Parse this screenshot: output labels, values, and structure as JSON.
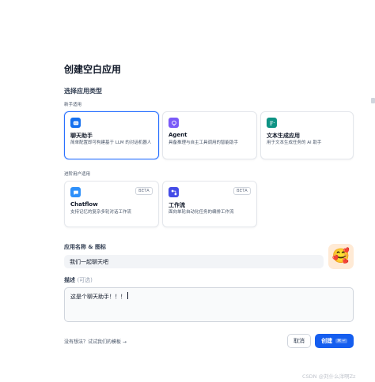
{
  "dialog": {
    "title": "创建空白应用",
    "section_title": "选择应用类型",
    "beginner_label": "新手适用",
    "advanced_label": "进阶用户适用"
  },
  "app_types": [
    {
      "name": "聊天助手",
      "desc": "简单配置即可构建基于 LLM 的对话机器人",
      "icon": "chat-bot-icon",
      "color": "#1570ef",
      "selected": true
    },
    {
      "name": "Agent",
      "desc": "具备推理与自主工具调用的智能助手",
      "icon": "agent-icon",
      "color": "#7a5af8",
      "selected": false
    },
    {
      "name": "文本生成应用",
      "desc": "用于文本生成任务的 AI 助手",
      "icon": "text-generator-icon",
      "color": "#0e9384",
      "selected": false
    },
    {
      "name": "Chatflow",
      "desc": "支持记忆的复杂多轮对话工作流",
      "icon": "chatflow-icon",
      "color": "#2e90fa",
      "badge": "BETA",
      "selected": false
    },
    {
      "name": "工作流",
      "desc": "面向单轮自动化任务的编排工作流",
      "icon": "workflow-icon",
      "color": "#444ce7",
      "badge": "BETA",
      "selected": false
    }
  ],
  "app_name": {
    "label": "应用名称 & 图标",
    "value": "我们一起聊天吧",
    "emoji": "🥰",
    "emoji_bg": "#ffead5"
  },
  "description": {
    "label": "描述",
    "optional": "(可选)",
    "value": "这是个聊天助手！！！"
  },
  "footer": {
    "template_link": "没有想法？试试我们的模板 →",
    "cancel_label": "取消",
    "create_label": "创建",
    "create_shortcut": "⌘ ↵"
  },
  "watermark": "CSDN @刘什么洋啊Zz"
}
